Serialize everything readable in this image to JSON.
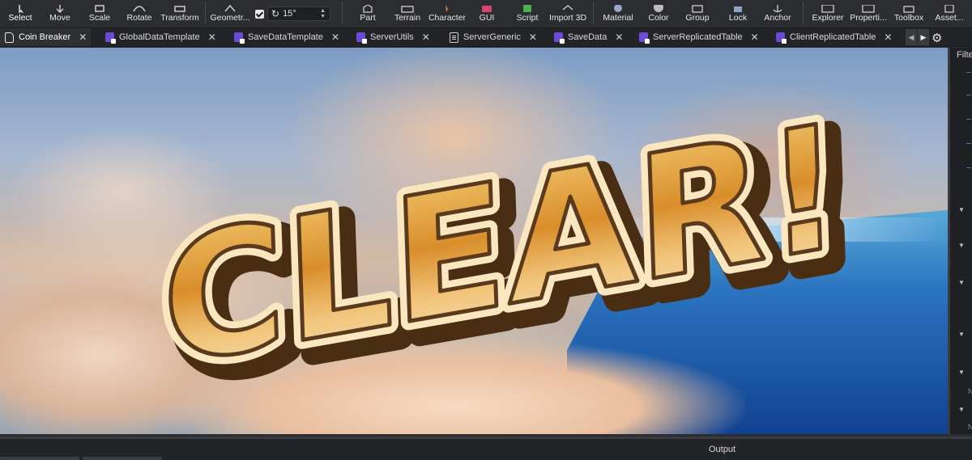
{
  "toolbar": {
    "tools": [
      {
        "label": "Select",
        "icon": "cursor-icon"
      },
      {
        "label": "Move",
        "icon": "move-icon"
      },
      {
        "label": "Scale",
        "icon": "scale-icon"
      },
      {
        "label": "Rotate",
        "icon": "rotate-icon"
      },
      {
        "label": "Transform",
        "icon": "transform-icon"
      },
      {
        "label": "Geometr...",
        "icon": "geometry-icon"
      },
      {
        "label": "Part",
        "icon": "part-icon"
      },
      {
        "label": "Terrain",
        "icon": "terrain-icon"
      },
      {
        "label": "Character",
        "icon": "character-icon"
      },
      {
        "label": "GUI",
        "icon": "gui-icon"
      },
      {
        "label": "Script",
        "icon": "script-icon"
      },
      {
        "label": "Import 3D",
        "icon": "import-3d-icon"
      },
      {
        "label": "Material",
        "icon": "material-icon"
      },
      {
        "label": "Color",
        "icon": "color-icon"
      },
      {
        "label": "Group",
        "icon": "group-icon"
      },
      {
        "label": "Lock",
        "icon": "lock-icon"
      },
      {
        "label": "Anchor",
        "icon": "anchor-icon"
      },
      {
        "label": "Explorer",
        "icon": "explorer-icon"
      },
      {
        "label": "Properti...",
        "icon": "properties-icon"
      },
      {
        "label": "Toolbox",
        "icon": "toolbox-icon"
      },
      {
        "label": "Asset...",
        "icon": "asset-manager-icon"
      }
    ],
    "rotation_snap": {
      "enabled": true,
      "value": "15°"
    }
  },
  "tabs": [
    {
      "label": "Coin Breaker",
      "kind": "place",
      "active": true
    },
    {
      "label": "GlobalDataTemplate",
      "kind": "script"
    },
    {
      "label": "SaveDataTemplate",
      "kind": "script"
    },
    {
      "label": "ServerUtils",
      "kind": "script"
    },
    {
      "label": "ServerGeneric",
      "kind": "doc"
    },
    {
      "label": "SaveData",
      "kind": "script"
    },
    {
      "label": "ServerReplicatedTable",
      "kind": "script"
    },
    {
      "label": "ClientReplicatedTable",
      "kind": "script"
    }
  ],
  "viewport": {
    "banner_text": "CLEAR!"
  },
  "right_panel": {
    "filter_label": "Filte",
    "row_letter": "N"
  },
  "output_panel": {
    "title": "Output"
  },
  "colors": {
    "toolbar_bg": "#2b2d30",
    "tab_active_bg": "#2e3034",
    "script_icon": "#6b4ad6",
    "banner_gold": "#e9a93c",
    "banner_outline": "#5a3a1c"
  }
}
